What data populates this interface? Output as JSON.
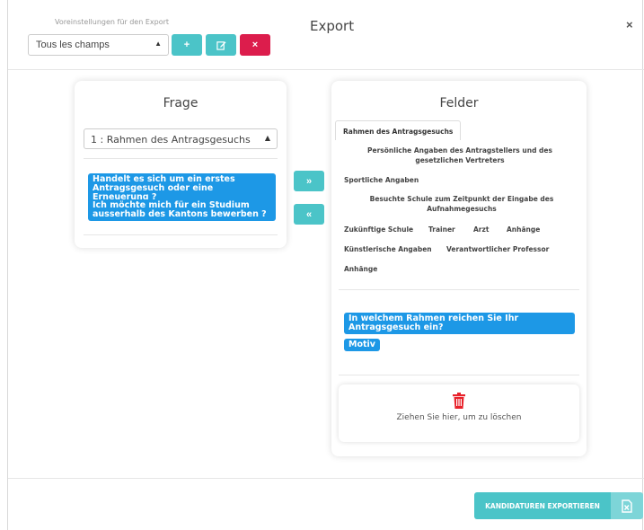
{
  "header": {
    "preset_label": "Voreinstellungen für den Export",
    "preset_value": "Tous les champs",
    "add_label": "+",
    "close_btn_label": "×",
    "title": "Export",
    "close_label": "×"
  },
  "frage": {
    "title": "Frage",
    "select_value": "1 : Rahmen des Antragsgesuchs",
    "items": [
      "Handelt es sich um ein erstes Antragsgesuch oder eine Erneuerung ?",
      "Ich möchte mich für ein Studium ausserhalb des Kantons bewerben ?"
    ]
  },
  "arrows": {
    "right": "»",
    "left": "«"
  },
  "felder": {
    "title": "Felder",
    "active_tab": "Rahmen des Antragsgesuchs",
    "fields": {
      "persoenlich": "Persönliche Angaben des Antragstellers und des gesetzlichen Vertreters",
      "sportlich": "Sportliche Angaben",
      "schule": "Besuchte Schule zum Zeitpunkt der Eingabe des Aufnahmegesuchs",
      "zukuenftig": "Zukünftige Schule",
      "trainer": "Trainer",
      "arzt": "Arzt",
      "anhaenge1": "Anhänge",
      "kuenstlerisch": "Künstlerische Angaben",
      "professor": "Verantwortlicher Professor",
      "anhaenge2": "Anhänge"
    },
    "selected": [
      "In welchem Rahmen reichen Sie Ihr Antragsgesuch ein?",
      "Motiv"
    ],
    "drop_text": "Ziehen Sie hier, um zu löschen"
  },
  "footer": {
    "export_label": "KANDIDATUREN EXPORTIEREN"
  },
  "colors": {
    "teal": "#4bc4c8",
    "red": "#dc1d4c",
    "chip_blue": "#1d98e6",
    "trash_red": "#e8212a"
  }
}
